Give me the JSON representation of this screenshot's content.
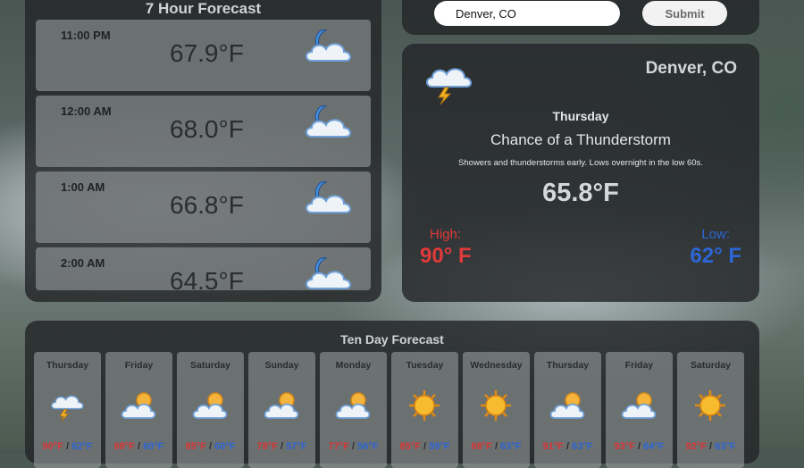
{
  "hourly": {
    "title": "7 Hour Forecast",
    "items": [
      {
        "time": "11:00 PM",
        "temp": "67.9°F",
        "icon": "moon-cloud-icon"
      },
      {
        "time": "12:00 AM",
        "temp": "68.0°F",
        "icon": "moon-cloud-icon"
      },
      {
        "time": "1:00 AM",
        "temp": "66.8°F",
        "icon": "moon-cloud-icon"
      },
      {
        "time": "2:00 AM",
        "temp": "64.5°F",
        "icon": "moon-cloud-icon"
      }
    ]
  },
  "search": {
    "value": "Denver, CO",
    "submit_label": "Submit"
  },
  "current": {
    "city": "Denver, CO",
    "icon": "thunderstorm-icon",
    "day": "Thursday",
    "condition": "Chance of a Thunderstorm",
    "description": "Showers and thunderstorms early. Lows overnight in the low 60s.",
    "temp": "65.8°F",
    "high_label": "High:",
    "high_value": "90° F",
    "low_label": "Low:",
    "low_value": "62° F"
  },
  "ten_day": {
    "title": "Ten Day Forecast",
    "separator": "/",
    "days": [
      {
        "name": "Thursday",
        "icon": "thunderstorm-icon",
        "hi": "90°F",
        "lo": "62°F"
      },
      {
        "name": "Friday",
        "icon": "partly-cloudy-icon",
        "hi": "88°F",
        "lo": "60°F"
      },
      {
        "name": "Saturday",
        "icon": "partly-cloudy-icon",
        "hi": "85°F",
        "lo": "60°F"
      },
      {
        "name": "Sunday",
        "icon": "partly-cloudy-icon",
        "hi": "78°F",
        "lo": "57°F"
      },
      {
        "name": "Monday",
        "icon": "partly-cloudy-icon",
        "hi": "77°F",
        "lo": "56°F"
      },
      {
        "name": "Tuesday",
        "icon": "sun-icon",
        "hi": "85°F",
        "lo": "59°F"
      },
      {
        "name": "Wednesday",
        "icon": "sun-icon",
        "hi": "88°F",
        "lo": "63°F"
      },
      {
        "name": "Thursday",
        "icon": "partly-cloudy-icon",
        "hi": "91°F",
        "lo": "63°F"
      },
      {
        "name": "Friday",
        "icon": "partly-cloudy-icon",
        "hi": "93°F",
        "lo": "64°F"
      },
      {
        "name": "Saturday",
        "icon": "sun-icon",
        "hi": "92°F",
        "lo": "63°F"
      }
    ]
  }
}
